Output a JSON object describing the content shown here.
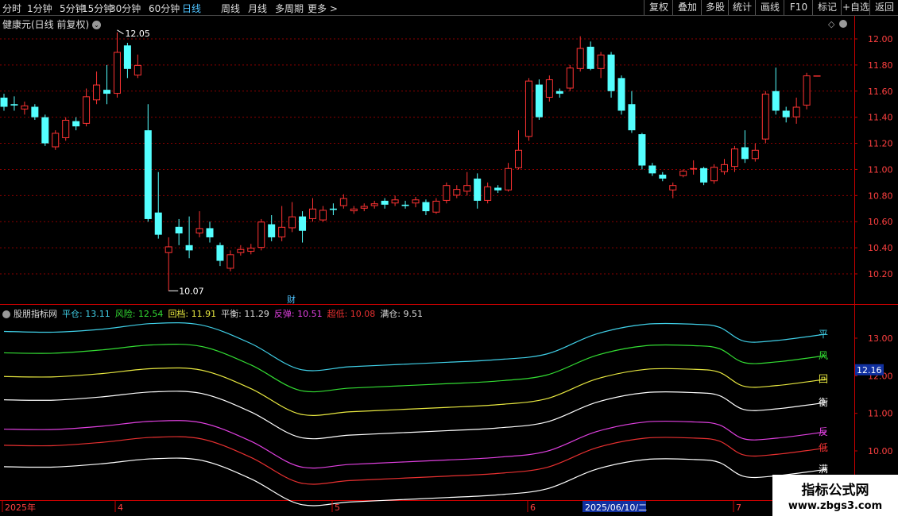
{
  "toolbar": {
    "periods": [
      "分时",
      "1分钟",
      "5分钟",
      "15分钟",
      "30分钟",
      "60分钟",
      "日线",
      "周线",
      "月线",
      "多周期",
      "更多 >"
    ],
    "active_period": "日线",
    "right_buttons": [
      "复权",
      "叠加",
      "多股",
      "统计",
      "画线",
      "F10",
      "标记",
      "+自选",
      "返回"
    ]
  },
  "stock": {
    "title": "健康元(日线 前复权)"
  },
  "price_axis": {
    "labels": [
      "12.00",
      "11.80",
      "11.60",
      "11.40",
      "11.20",
      "11.00",
      "10.80",
      "10.60",
      "10.40",
      "10.20"
    ]
  },
  "annotations": {
    "high": "12.05",
    "low": "10.07",
    "finance_marker": "财"
  },
  "indicator": {
    "name": "股朋指标网",
    "items": [
      {
        "label": "平仓:",
        "value": "13.11",
        "color": "#40d0e8"
      },
      {
        "label": "风险:",
        "value": "12.54",
        "color": "#33dd33"
      },
      {
        "label": "回档:",
        "value": "11.91",
        "color": "#e8e840"
      },
      {
        "label": "平衡:",
        "value": "11.29",
        "color": "#ffffff"
      },
      {
        "label": "反弹:",
        "value": "10.51",
        "color": "#e040e0"
      },
      {
        "label": "超低:",
        "value": "10.08",
        "color": "#e83030"
      },
      {
        "label": "满仓:",
        "value": "9.51",
        "color": "#ffffff"
      }
    ],
    "axis_labels": [
      "13.00",
      "12.00",
      "11.00",
      "10.00"
    ],
    "current_value": "12.16",
    "line_tags": [
      "平",
      "风",
      "回",
      "衡",
      "反",
      "低",
      "满"
    ]
  },
  "date_axis": {
    "labels": [
      "2025年",
      "4",
      "5",
      "6",
      "2025/06/10/二",
      "7"
    ]
  },
  "watermark": {
    "title": "指标公式网",
    "url": "www.zbgs3.com"
  },
  "colors": {
    "up": "#ff3333",
    "down": "#54ffff",
    "grid": "#8b0000",
    "active": "#4fc3ff"
  },
  "chart_data": {
    "type": "candlestick",
    "ylim": [
      10.12,
      12.06
    ],
    "candles": [
      {
        "o": 11.55,
        "c": 11.48,
        "h": 11.58,
        "l": 11.45
      },
      {
        "o": 11.5,
        "c": 11.49,
        "h": 11.56,
        "l": 11.45
      },
      {
        "o": 11.46,
        "c": 11.49,
        "h": 11.52,
        "l": 11.42
      },
      {
        "o": 11.48,
        "c": 11.4,
        "h": 11.5,
        "l": 11.38
      },
      {
        "o": 11.4,
        "c": 11.2,
        "h": 11.42,
        "l": 11.18
      },
      {
        "o": 11.17,
        "c": 11.28,
        "h": 11.3,
        "l": 11.15
      },
      {
        "o": 11.24,
        "c": 11.38,
        "h": 11.4,
        "l": 11.22
      },
      {
        "o": 11.37,
        "c": 11.33,
        "h": 11.4,
        "l": 11.3
      },
      {
        "o": 11.35,
        "c": 11.56,
        "h": 11.62,
        "l": 11.33
      },
      {
        "o": 11.53,
        "c": 11.65,
        "h": 11.75,
        "l": 11.5
      },
      {
        "o": 11.61,
        "c": 11.58,
        "h": 11.8,
        "l": 11.5
      },
      {
        "o": 11.58,
        "c": 11.9,
        "h": 12.05,
        "l": 11.55
      },
      {
        "o": 11.95,
        "c": 11.77,
        "h": 11.97,
        "l": 11.7
      },
      {
        "o": 11.72,
        "c": 11.8,
        "h": 11.88,
        "l": 11.7
      },
      {
        "o": 11.3,
        "c": 10.62,
        "h": 11.5,
        "l": 10.6
      },
      {
        "o": 10.67,
        "c": 10.5,
        "h": 10.98,
        "l": 10.47
      },
      {
        "o": 10.36,
        "c": 10.41,
        "h": 10.48,
        "l": 10.07
      },
      {
        "o": 10.56,
        "c": 10.51,
        "h": 10.62,
        "l": 10.42
      },
      {
        "o": 10.42,
        "c": 10.38,
        "h": 10.64,
        "l": 10.32
      },
      {
        "o": 10.51,
        "c": 10.55,
        "h": 10.68,
        "l": 10.48
      },
      {
        "o": 10.55,
        "c": 10.48,
        "h": 10.6,
        "l": 10.44
      },
      {
        "o": 10.42,
        "c": 10.3,
        "h": 10.44,
        "l": 10.26
      },
      {
        "o": 10.24,
        "c": 10.35,
        "h": 10.38,
        "l": 10.22
      },
      {
        "o": 10.36,
        "c": 10.39,
        "h": 10.42,
        "l": 10.34
      },
      {
        "o": 10.37,
        "c": 10.4,
        "h": 10.43,
        "l": 10.35
      },
      {
        "o": 10.4,
        "c": 10.6,
        "h": 10.62,
        "l": 10.38
      },
      {
        "o": 10.58,
        "c": 10.48,
        "h": 10.65,
        "l": 10.45
      },
      {
        "o": 10.48,
        "c": 10.56,
        "h": 10.72,
        "l": 10.45
      },
      {
        "o": 10.55,
        "c": 10.64,
        "h": 10.75,
        "l": 10.52
      },
      {
        "o": 10.64,
        "c": 10.53,
        "h": 10.68,
        "l": 10.44
      },
      {
        "o": 10.62,
        "c": 10.7,
        "h": 10.78,
        "l": 10.6
      },
      {
        "o": 10.61,
        "c": 10.69,
        "h": 10.72,
        "l": 10.6
      },
      {
        "o": 10.7,
        "c": 10.69,
        "h": 10.74,
        "l": 10.65
      },
      {
        "o": 10.72,
        "c": 10.78,
        "h": 10.81,
        "l": 10.7
      },
      {
        "o": 10.68,
        "c": 10.7,
        "h": 10.72,
        "l": 10.66
      },
      {
        "o": 10.7,
        "c": 10.72,
        "h": 10.74,
        "l": 10.68
      },
      {
        "o": 10.72,
        "c": 10.74,
        "h": 10.76,
        "l": 10.7
      },
      {
        "o": 10.76,
        "c": 10.73,
        "h": 10.78,
        "l": 10.7
      },
      {
        "o": 10.74,
        "c": 10.77,
        "h": 10.8,
        "l": 10.72
      },
      {
        "o": 10.73,
        "c": 10.72,
        "h": 10.76,
        "l": 10.7
      },
      {
        "o": 10.74,
        "c": 10.77,
        "h": 10.79,
        "l": 10.71
      },
      {
        "o": 10.75,
        "c": 10.68,
        "h": 10.77,
        "l": 10.65
      },
      {
        "o": 10.67,
        "c": 10.76,
        "h": 10.78,
        "l": 10.66
      },
      {
        "o": 10.76,
        "c": 10.88,
        "h": 10.9,
        "l": 10.74
      },
      {
        "o": 10.8,
        "c": 10.85,
        "h": 10.88,
        "l": 10.78
      },
      {
        "o": 10.83,
        "c": 10.88,
        "h": 10.98,
        "l": 10.8
      },
      {
        "o": 10.93,
        "c": 10.76,
        "h": 10.97,
        "l": 10.7
      },
      {
        "o": 10.76,
        "c": 10.87,
        "h": 10.9,
        "l": 10.74
      },
      {
        "o": 10.86,
        "c": 10.84,
        "h": 10.88,
        "l": 10.82
      },
      {
        "o": 10.84,
        "c": 11.01,
        "h": 11.05,
        "l": 10.83
      },
      {
        "o": 11.01,
        "c": 11.15,
        "h": 11.3,
        "l": 11.0
      },
      {
        "o": 11.25,
        "c": 11.68,
        "h": 11.7,
        "l": 11.22
      },
      {
        "o": 11.65,
        "c": 11.4,
        "h": 11.69,
        "l": 11.38
      },
      {
        "o": 11.55,
        "c": 11.69,
        "h": 11.72,
        "l": 11.52
      },
      {
        "o": 11.6,
        "c": 11.58,
        "h": 11.62,
        "l": 11.55
      },
      {
        "o": 11.62,
        "c": 11.78,
        "h": 11.8,
        "l": 11.6
      },
      {
        "o": 11.77,
        "c": 11.93,
        "h": 12.02,
        "l": 11.75
      },
      {
        "o": 11.94,
        "c": 11.77,
        "h": 11.98,
        "l": 11.76
      },
      {
        "o": 11.77,
        "c": 11.88,
        "h": 11.9,
        "l": 11.7
      },
      {
        "o": 11.88,
        "c": 11.6,
        "h": 11.9,
        "l": 11.55
      },
      {
        "o": 11.7,
        "c": 11.45,
        "h": 11.72,
        "l": 11.42
      },
      {
        "o": 11.5,
        "c": 11.3,
        "h": 11.6,
        "l": 11.28
      },
      {
        "o": 11.27,
        "c": 11.03,
        "h": 11.28,
        "l": 11.0
      },
      {
        "o": 11.03,
        "c": 10.97,
        "h": 11.05,
        "l": 10.95
      },
      {
        "o": 10.96,
        "c": 10.93,
        "h": 10.98,
        "l": 10.91
      },
      {
        "o": 10.84,
        "c": 10.88,
        "h": 10.9,
        "l": 10.78
      },
      {
        "o": 10.95,
        "c": 10.99,
        "h": 11.0,
        "l": 10.94
      },
      {
        "o": 11.0,
        "c": 11.01,
        "h": 11.07,
        "l": 10.96
      },
      {
        "o": 11.01,
        "c": 10.9,
        "h": 11.02,
        "l": 10.88
      },
      {
        "o": 10.91,
        "c": 11.02,
        "h": 11.04,
        "l": 10.89
      },
      {
        "o": 10.98,
        "c": 11.04,
        "h": 11.08,
        "l": 10.96
      },
      {
        "o": 11.02,
        "c": 11.16,
        "h": 11.18,
        "l": 10.98
      },
      {
        "o": 11.17,
        "c": 11.08,
        "h": 11.3,
        "l": 11.05
      },
      {
        "o": 11.08,
        "c": 11.15,
        "h": 11.2,
        "l": 11.06
      },
      {
        "o": 11.23,
        "c": 11.58,
        "h": 11.6,
        "l": 11.2
      },
      {
        "o": 11.6,
        "c": 11.45,
        "h": 11.78,
        "l": 11.42
      },
      {
        "o": 11.45,
        "c": 11.4,
        "h": 11.48,
        "l": 11.36
      },
      {
        "o": 11.4,
        "c": 11.48,
        "h": 11.55,
        "l": 11.35
      },
      {
        "o": 11.49,
        "c": 11.72,
        "h": 11.74,
        "l": 11.46
      },
      {
        "o": 11.72,
        "c": 11.72,
        "h": 11.72,
        "l": 11.72
      }
    ],
    "bands": {
      "ylim": [
        9.33,
        13.93
      ],
      "x": [
        0,
        0.06,
        0.12,
        0.18,
        0.24,
        0.3,
        0.36,
        0.42,
        0.48,
        0.54,
        0.6,
        0.66,
        0.72,
        0.78,
        0.84,
        0.87,
        0.9,
        0.94,
        1.0
      ],
      "series": [
        {
          "name": "平仓",
          "color": "#40d0e8",
          "values": [
            13.18,
            13.16,
            13.24,
            13.39,
            13.35,
            12.86,
            12.17,
            12.24,
            12.3,
            12.36,
            12.43,
            12.58,
            13.11,
            13.37,
            13.37,
            13.29,
            12.92,
            12.94,
            13.11
          ]
        },
        {
          "name": "风险",
          "color": "#33dd33",
          "values": [
            12.61,
            12.6,
            12.69,
            12.82,
            12.78,
            12.29,
            11.61,
            11.67,
            11.73,
            11.79,
            11.86,
            12.02,
            12.54,
            12.8,
            12.8,
            12.72,
            12.35,
            12.37,
            12.54
          ]
        },
        {
          "name": "回档",
          "color": "#e8e840",
          "values": [
            11.98,
            11.97,
            12.06,
            12.19,
            12.15,
            11.66,
            10.98,
            11.04,
            11.1,
            11.16,
            11.23,
            11.39,
            11.91,
            12.17,
            12.17,
            12.09,
            11.72,
            11.74,
            11.91
          ]
        },
        {
          "name": "平衡",
          "color": "#ffffff",
          "values": [
            11.36,
            11.35,
            11.44,
            11.57,
            11.53,
            11.04,
            10.36,
            10.42,
            10.48,
            10.54,
            10.61,
            10.77,
            11.29,
            11.55,
            11.55,
            11.47,
            11.1,
            11.12,
            11.29
          ]
        },
        {
          "name": "反弹",
          "color": "#e040e0",
          "values": [
            10.58,
            10.57,
            10.66,
            10.79,
            10.75,
            10.26,
            9.58,
            9.64,
            9.7,
            9.76,
            9.83,
            9.99,
            10.51,
            10.77,
            10.77,
            10.69,
            10.32,
            10.34,
            10.51
          ]
        },
        {
          "name": "超低",
          "color": "#e83030",
          "values": [
            10.15,
            10.14,
            10.23,
            10.36,
            10.32,
            9.83,
            9.15,
            9.21,
            9.27,
            9.33,
            9.4,
            9.56,
            10.08,
            10.34,
            10.34,
            10.26,
            9.89,
            9.91,
            10.08
          ]
        },
        {
          "name": "满仓",
          "color": "#ffffff",
          "values": [
            9.58,
            9.57,
            9.66,
            9.79,
            9.75,
            9.26,
            8.58,
            8.64,
            8.7,
            8.76,
            8.83,
            8.99,
            9.51,
            9.77,
            9.77,
            9.69,
            9.32,
            9.34,
            9.51
          ]
        }
      ]
    }
  }
}
